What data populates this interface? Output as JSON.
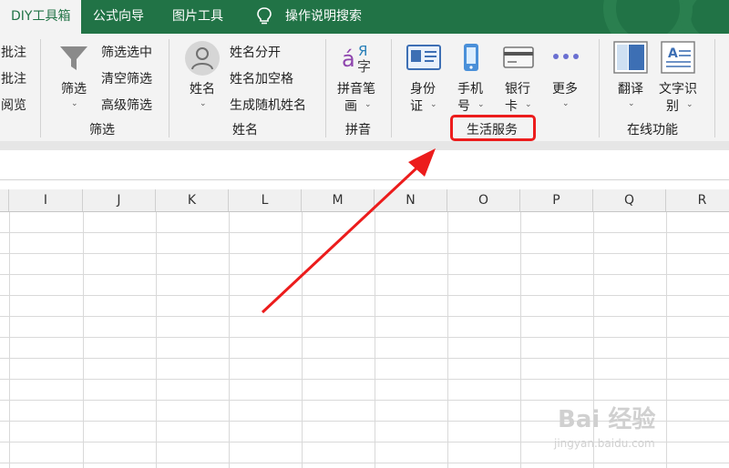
{
  "tabs": [
    {
      "label": "DIY工具箱",
      "active": true
    },
    {
      "label": "公式向导",
      "active": false
    },
    {
      "label": "图片工具",
      "active": false
    },
    {
      "label": "操作说明搜索",
      "active": false
    }
  ],
  "ribbon": {
    "comment": {
      "items": [
        "批注",
        "批注",
        "阅览"
      ]
    },
    "filter": {
      "main_label": "筛选",
      "items": [
        "筛选选中",
        "清空筛选",
        "高级筛选"
      ],
      "group_label": "筛选"
    },
    "name": {
      "main_label": "姓名",
      "items": [
        "姓名分开",
        "姓名加空格",
        "生成随机姓名"
      ],
      "group_label": "姓名"
    },
    "pinyin": {
      "main_label_1": "拼音笔",
      "main_label_2": "画",
      "group_label": "拼音"
    },
    "life": {
      "id_card_1": "身份",
      "id_card_2": "证",
      "phone_1": "手机",
      "phone_2": "号",
      "bank_1": "银行",
      "bank_2": "卡",
      "more": "更多",
      "group_label": "生活服务"
    },
    "online": {
      "translate": "翻译",
      "ocr_1": "文字识",
      "ocr_2": "别",
      "group_label": "在线功能"
    }
  },
  "columns": [
    "I",
    "J",
    "K",
    "L",
    "M",
    "N",
    "O",
    "P",
    "Q",
    "R"
  ],
  "watermark": {
    "main": "Bai 经验",
    "sub": "jingyan.baidu.com"
  },
  "colors": {
    "accent": "#217346",
    "highlight": "#ec1c1c"
  }
}
